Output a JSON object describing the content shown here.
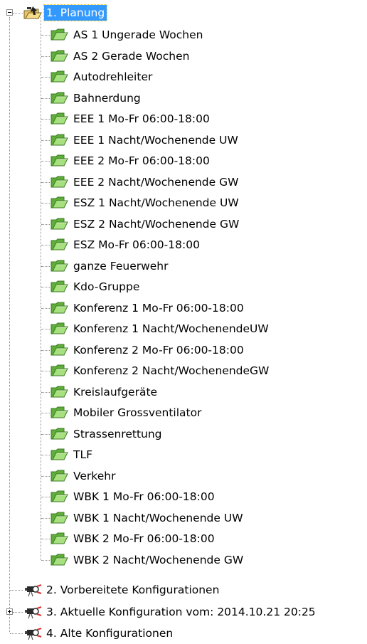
{
  "root": {
    "label": "1. Planung",
    "expanded": true,
    "icon": "settings-folder-icon"
  },
  "children": [
    "AS 1 Ungerade Wochen",
    "AS 2 Gerade Wochen",
    "Autodrehleiter",
    "Bahnerdung",
    "EEE 1 Mo-Fr 06:00-18:00",
    "EEE 1 Nacht/Wochenende UW",
    "EEE 2 Mo-Fr 06:00-18:00",
    "EEE 2 Nacht/Wochenende GW",
    "ESZ 1 Nacht/Wochenende UW",
    "ESZ 2 Nacht/Wochenende GW",
    "ESZ Mo-Fr 06:00-18:00",
    "ganze Feuerwehr",
    "Kdo-Gruppe",
    "Konferenz 1 Mo-Fr 06:00-18:00",
    "Konferenz 1 Nacht/WochenendeUW",
    "Konferenz 2 Mo-Fr 06:00-18:00",
    "Konferenz 2 Nacht/WochenendeGW",
    "Kreislaufgeräte",
    "Mobiler Grossventilator",
    "Strassenrettung",
    "TLF",
    "Verkehr",
    "WBK 1 Mo-Fr 06:00-18:00",
    "WBK 1 Nacht/Wochenende UW",
    "WBK 2 Mo-Fr 06:00-18:00",
    "WBK 2 Nacht/Wochenende GW"
  ],
  "siblings": [
    {
      "label": "2. Vorbereitete Konfigurationen",
      "expandable": false
    },
    {
      "label": "3. Aktuelle Konfiguration vom: 2014.10.21 20:25",
      "expandable": true
    },
    {
      "label": "4. Alte Konfigurationen",
      "expandable": false
    }
  ],
  "colors": {
    "selection": "#3399ff",
    "folder": "#8fd16a",
    "tree_line": "#8f8f8f"
  }
}
